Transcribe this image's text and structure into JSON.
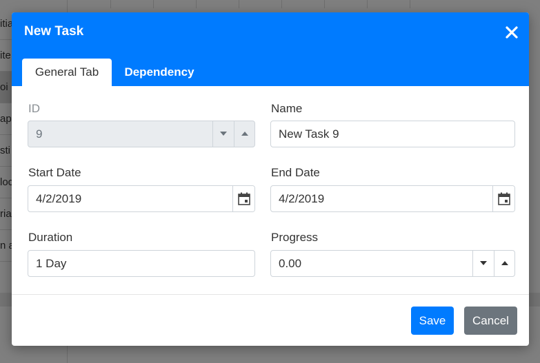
{
  "background": {
    "row_texts": [
      "itia",
      "ite",
      "oi",
      "app",
      "sti",
      "loc",
      "ria",
      "n a"
    ]
  },
  "dialog": {
    "title": "New Task",
    "close_icon": "close-icon",
    "tabs": [
      {
        "label": "General Tab",
        "active": true
      },
      {
        "label": "Dependency",
        "active": false
      }
    ],
    "fields": {
      "id": {
        "label": "ID",
        "value": "9",
        "disabled": true
      },
      "name": {
        "label": "Name",
        "value": "New Task 9"
      },
      "start_date": {
        "label": "Start Date",
        "value": "4/2/2019"
      },
      "end_date": {
        "label": "End Date",
        "value": "4/2/2019"
      },
      "duration": {
        "label": "Duration",
        "value": "1 Day"
      },
      "progress": {
        "label": "Progress",
        "value": "0.00"
      }
    },
    "buttons": {
      "save": "Save",
      "cancel": "Cancel"
    }
  },
  "colors": {
    "primary": "#007bff",
    "secondary": "#6c757d",
    "disabled_bg": "#e9ecef",
    "border": "#ced4da"
  }
}
